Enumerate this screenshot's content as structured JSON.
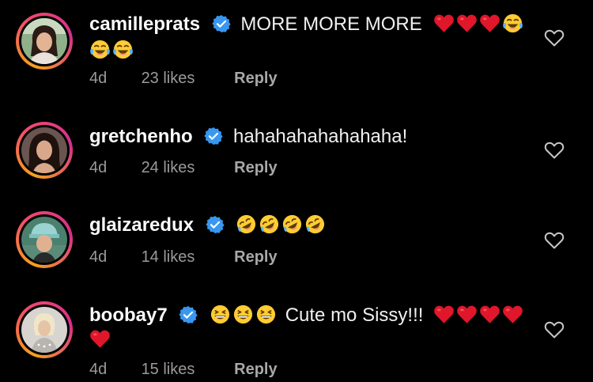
{
  "comments": [
    {
      "username": "camilleprats",
      "verified": true,
      "text": "MORE MORE MORE",
      "text_emojis": [
        "red-heart",
        "red-heart",
        "red-heart",
        "tears-of-joy"
      ],
      "wrap_emojis": [
        "tears-of-joy",
        "tears-of-joy"
      ],
      "time": "4d",
      "likes": "23 likes",
      "reply": "Reply"
    },
    {
      "username": "gretchenho",
      "verified": true,
      "text": "hahahahahahahaha!",
      "time": "4d",
      "likes": "24 likes",
      "reply": "Reply"
    },
    {
      "username": "glaizaredux",
      "verified": true,
      "text": "",
      "text_emojis": [
        "rofl",
        "rofl",
        "rofl",
        "rofl"
      ],
      "time": "4d",
      "likes": "14 likes",
      "reply": "Reply"
    },
    {
      "username": "boobay7",
      "verified": true,
      "lead_emojis": [
        "grinning-squint",
        "grinning-squint",
        "grinning-squint"
      ],
      "text": "Cute mo Sissy!!!",
      "text_emojis": [
        "red-heart",
        "red-heart",
        "red-heart",
        "red-heart"
      ],
      "wrap_emojis": [
        "red-heart"
      ],
      "time": "4d",
      "likes": "15 likes",
      "reply": "Reply"
    }
  ],
  "colors": {
    "background": "#000000",
    "verified_badge": "#3897f0",
    "meta_text": "#9a9a9a",
    "heart_emoji": "#e0162b"
  }
}
